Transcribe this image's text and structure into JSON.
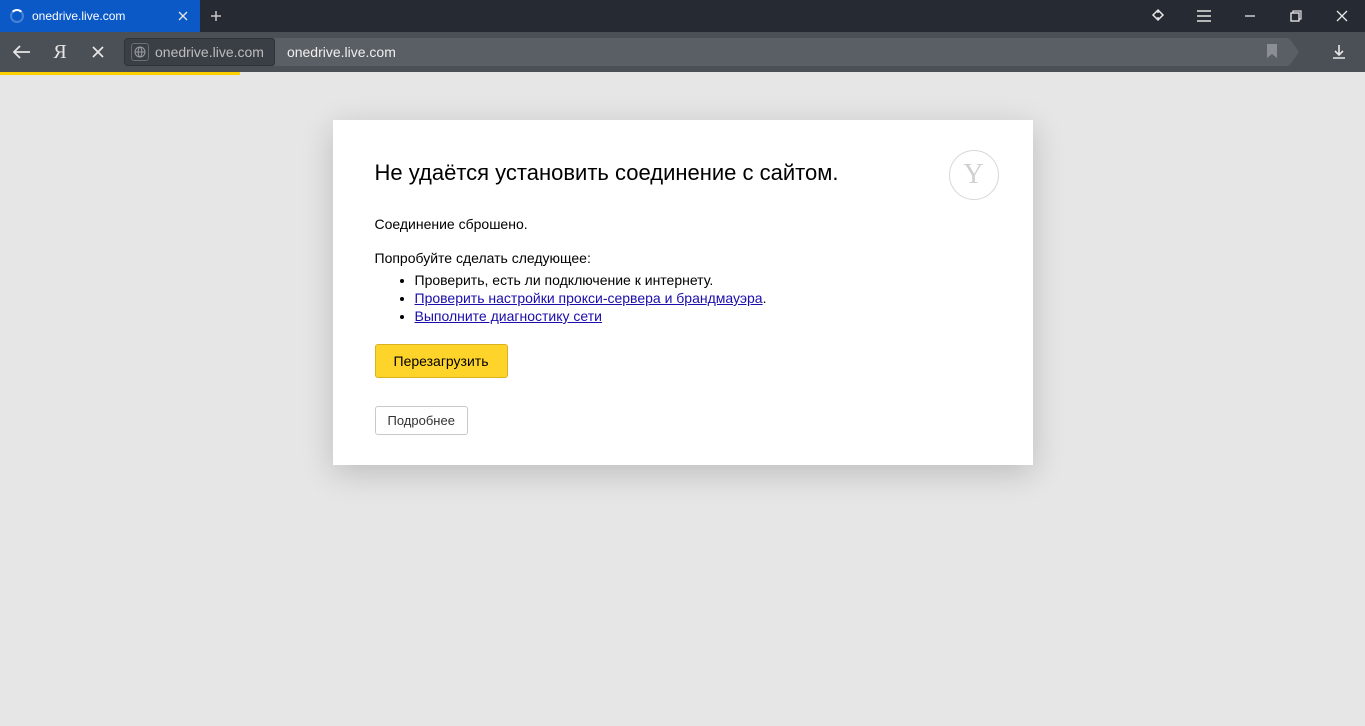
{
  "tab": {
    "title": "onedrive.live.com"
  },
  "address": {
    "chip": "onedrive.live.com",
    "rest": "onedrive.live.com"
  },
  "error": {
    "heading": "Не удаётся установить соединение с сайтом.",
    "sub": "Соединение сброшено.",
    "try_label": "Попробуйте сделать следующее:",
    "items": {
      "0": "Проверить, есть ли подключение к интернету.",
      "1": "Проверить настройки прокси-сервера и брандмауэра",
      "1_suffix": ".",
      "2": "Выполните диагностику сети"
    },
    "reload_btn": "Перезагрузить",
    "details_btn": "Подробнее"
  }
}
